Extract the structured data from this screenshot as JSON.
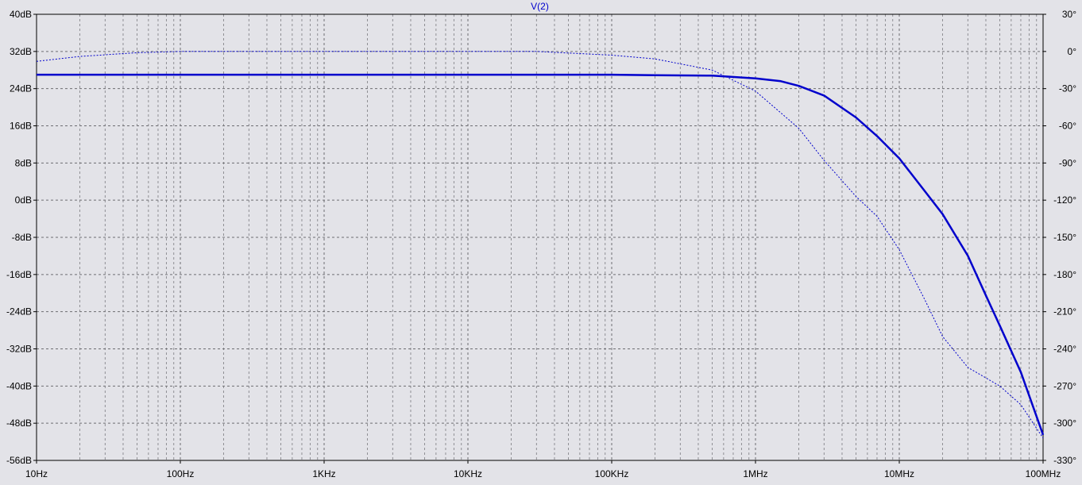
{
  "chart_data": {
    "type": "line",
    "title": "V(2)",
    "x_scale": "log",
    "xlim": [
      10,
      100000000
    ],
    "x_ticks": [
      {
        "value": 10,
        "label": "10Hz"
      },
      {
        "value": 100,
        "label": "100Hz"
      },
      {
        "value": 1000,
        "label": "1KHz"
      },
      {
        "value": 10000,
        "label": "10KHz"
      },
      {
        "value": 100000,
        "label": "100KHz"
      },
      {
        "value": 1000000,
        "label": "1MHz"
      },
      {
        "value": 10000000,
        "label": "10MHz"
      },
      {
        "value": 100000000,
        "label": "100MHz"
      }
    ],
    "y_left": {
      "unit": "dB",
      "range": [
        -56,
        40
      ],
      "ticks": [
        {
          "value": 40,
          "label": "40dB"
        },
        {
          "value": 32,
          "label": "32dB"
        },
        {
          "value": 24,
          "label": "24dB"
        },
        {
          "value": 16,
          "label": "16dB"
        },
        {
          "value": 8,
          "label": "8dB"
        },
        {
          "value": 0,
          "label": "0dB"
        },
        {
          "value": -8,
          "label": "-8dB"
        },
        {
          "value": -16,
          "label": "-16dB"
        },
        {
          "value": -24,
          "label": "-24dB"
        },
        {
          "value": -32,
          "label": "-32dB"
        },
        {
          "value": -40,
          "label": "-40dB"
        },
        {
          "value": -48,
          "label": "-48dB"
        },
        {
          "value": -56,
          "label": "-56dB"
        }
      ]
    },
    "y_right": {
      "unit": "degrees",
      "range": [
        -330,
        30
      ],
      "ticks": [
        {
          "value": 30,
          "label": "30°"
        },
        {
          "value": 0,
          "label": "0°"
        },
        {
          "value": -30,
          "label": "-30°"
        },
        {
          "value": -60,
          "label": "-60°"
        },
        {
          "value": -90,
          "label": "-90°"
        },
        {
          "value": -120,
          "label": "-120°"
        },
        {
          "value": -150,
          "label": "-150°"
        },
        {
          "value": -180,
          "label": "-180°"
        },
        {
          "value": -210,
          "label": "-210°"
        },
        {
          "value": -240,
          "label": "-240°"
        },
        {
          "value": -270,
          "label": "-270°"
        },
        {
          "value": -300,
          "label": "-300°"
        },
        {
          "value": -330,
          "label": "-330°"
        }
      ]
    },
    "grid": true,
    "series": [
      {
        "axis": "left",
        "style": "solid",
        "color": "#0000cc",
        "points": [
          [
            10,
            27.0
          ],
          [
            1000,
            27.0
          ],
          [
            100000,
            27.0
          ],
          [
            200000,
            26.9
          ],
          [
            500000,
            26.8
          ],
          [
            1000000,
            26.2
          ],
          [
            1500000,
            25.6
          ],
          [
            2000000,
            24.6
          ],
          [
            3000000,
            22.5
          ],
          [
            5000000,
            17.8
          ],
          [
            7000000,
            13.8
          ],
          [
            10000000,
            9.0
          ],
          [
            15000000,
            2.0
          ],
          [
            20000000,
            -3.0
          ],
          [
            30000000,
            -12.0
          ],
          [
            40000000,
            -20.5
          ],
          [
            50000000,
            -27.0
          ],
          [
            70000000,
            -37.0
          ],
          [
            100000000,
            -50.5
          ]
        ]
      },
      {
        "axis": "right",
        "style": "dotted",
        "color": "#0000cc",
        "points": [
          [
            10,
            -8
          ],
          [
            20,
            -4
          ],
          [
            50,
            -1
          ],
          [
            100,
            0
          ],
          [
            1000,
            0
          ],
          [
            10000,
            0
          ],
          [
            30000,
            0
          ],
          [
            100000,
            -3
          ],
          [
            200000,
            -6
          ],
          [
            500000,
            -15
          ],
          [
            1000000,
            -32
          ],
          [
            2000000,
            -62
          ],
          [
            3000000,
            -88
          ],
          [
            5000000,
            -117
          ],
          [
            7000000,
            -133
          ],
          [
            10000000,
            -160
          ],
          [
            15000000,
            -200
          ],
          [
            20000000,
            -230
          ],
          [
            30000000,
            -255
          ],
          [
            50000000,
            -270
          ],
          [
            70000000,
            -285
          ],
          [
            100000000,
            -312
          ]
        ]
      }
    ]
  }
}
